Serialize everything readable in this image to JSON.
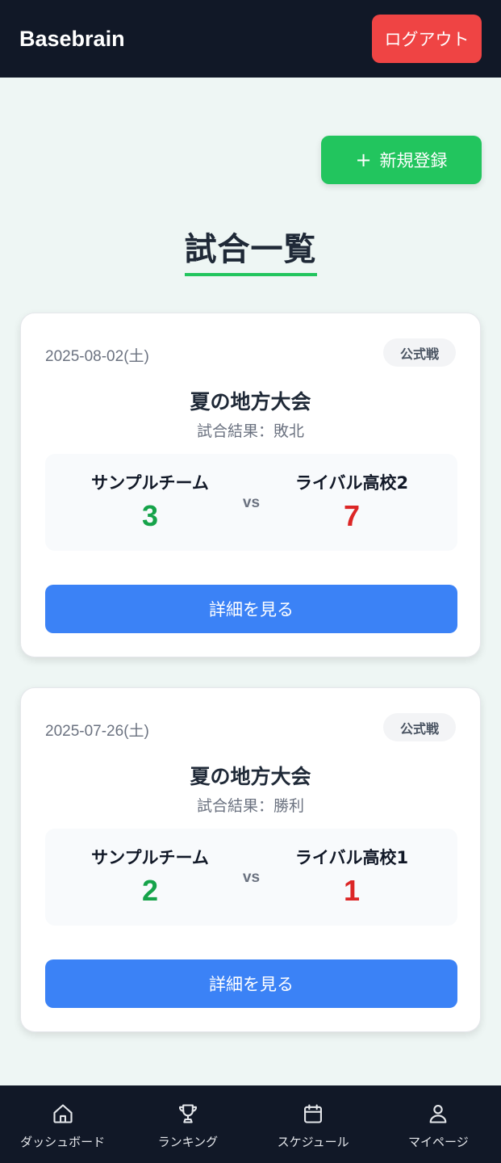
{
  "header": {
    "brand": "Basebrain",
    "logout_label": "ログアウト"
  },
  "actions": {
    "new_label": "新規登録",
    "new_icon": "plus-icon"
  },
  "page": {
    "title": "試合一覧"
  },
  "matches": [
    {
      "date": "2025-08-02(土)",
      "badge": "公式戦",
      "tournament": "夏の地方大会",
      "result": "試合結果：敗北",
      "home_team": "サンプルチーム",
      "home_score": "3",
      "vs": "vs",
      "away_team": "ライバル高校2",
      "away_score": "7",
      "detail_label": "詳細を見る"
    },
    {
      "date": "2025-07-26(土)",
      "badge": "公式戦",
      "tournament": "夏の地方大会",
      "result": "試合結果：勝利",
      "home_team": "サンプルチーム",
      "home_score": "2",
      "vs": "vs",
      "away_team": "ライバル高校1",
      "away_score": "1",
      "detail_label": "詳細を見る"
    }
  ],
  "bottom_nav": {
    "items": [
      {
        "label": "ダッシュボード",
        "icon": "home-icon"
      },
      {
        "label": "ランキング",
        "icon": "trophy-icon"
      },
      {
        "label": "スケジュール",
        "icon": "calendar-icon"
      },
      {
        "label": "マイページ",
        "icon": "user-icon"
      }
    ]
  },
  "colors": {
    "header_bg": "#111827",
    "page_bg": "#eef6f4",
    "logout": "#ef4444",
    "new_button": "#22c55e",
    "detail_button": "#3b82f6",
    "win_score": "#16a34a",
    "loss_score": "#dc2626",
    "title_underline": "#22c55e"
  }
}
